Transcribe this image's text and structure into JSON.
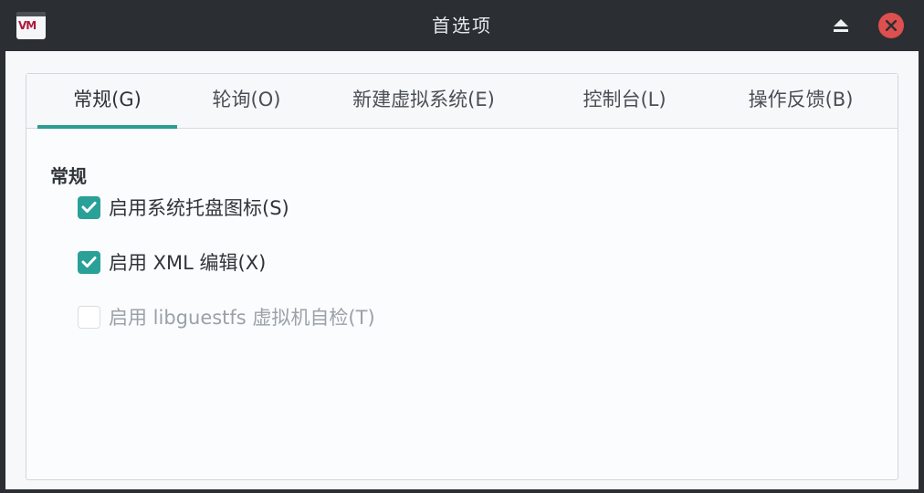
{
  "window": {
    "title": "首选项",
    "app_icon_text": "VM",
    "colors": {
      "titlebar": "#2b2f33",
      "accent": "#2aa198",
      "close": "#de4f4f"
    }
  },
  "tabs": [
    {
      "label": "常规(G)",
      "active": true
    },
    {
      "label": "轮询(O)",
      "active": false
    },
    {
      "label": "新建虚拟系统(E)",
      "active": false
    },
    {
      "label": "控制台(L)",
      "active": false
    },
    {
      "label": "操作反馈(B)",
      "active": false
    }
  ],
  "general": {
    "heading": "常规",
    "options": [
      {
        "label": "启用系统托盘图标(S)",
        "checked": true,
        "enabled": true
      },
      {
        "label": "启用 XML 编辑(X)",
        "checked": true,
        "enabled": true
      },
      {
        "label": "启用 libguestfs 虚拟机自检(T)",
        "checked": false,
        "enabled": false
      }
    ]
  }
}
